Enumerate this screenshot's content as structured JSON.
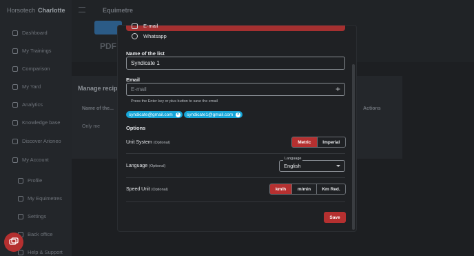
{
  "app": {
    "brand_prefix": "Horsotech",
    "user_name": "Charlotte",
    "page_title": "Equimetre",
    "background_heading": "PDF",
    "manage_heading": "Manage recip",
    "table": {
      "col_name": "Name of the...",
      "col_actions": "Actions",
      "row_1": "Only me"
    }
  },
  "sidebar": {
    "items": [
      {
        "label": "Dashboard",
        "icon": "grid-icon"
      },
      {
        "label": "My Trainings",
        "icon": "horse-icon"
      },
      {
        "label": "Comparison",
        "icon": "compare-icon"
      },
      {
        "label": "My Yard",
        "icon": "yard-icon"
      },
      {
        "label": "Analytics",
        "icon": "analytics-icon"
      },
      {
        "label": "Knowledge base",
        "icon": "bulb-icon"
      },
      {
        "label": "Discover Arioneo",
        "icon": "globe-icon"
      },
      {
        "label": "My Account",
        "icon": "users-icon"
      }
    ],
    "subitems": [
      {
        "label": "Profile",
        "icon": "user-icon"
      },
      {
        "label": "My Equimetres",
        "icon": "device-icon"
      },
      {
        "label": "Settings",
        "icon": "gear-icon"
      },
      {
        "label": "Back office",
        "icon": "office-icon"
      },
      {
        "label": "Help & Support",
        "icon": "help-icon"
      }
    ]
  },
  "modal": {
    "share_options": [
      {
        "label": "E-mail",
        "icon": "mail-icon"
      },
      {
        "label": "Whatsapp",
        "icon": "whatsapp-icon"
      }
    ],
    "name_label": "Name of the list",
    "name_value": "Syndicate 1",
    "email_label": "Email",
    "email_placeholder": "E-mail",
    "email_hint": "Press the Enter key or plus button to save the email",
    "emails": [
      "syndicate@gmail.com",
      "syndicate1@gmail.com"
    ],
    "options_label": "Options",
    "unit_system": {
      "label": "Unit System",
      "optional": "(Optional)",
      "choices": [
        "Metric",
        "Imperial"
      ],
      "selected": "Metric"
    },
    "language": {
      "label": "Language",
      "optional": "(Optional)",
      "legend": "Language",
      "value": "English"
    },
    "speed_unit": {
      "label": "Speed Unit",
      "optional": "(Optional)",
      "choices": [
        "km/h",
        "m/min",
        "Km Red."
      ],
      "selected": "km/h"
    },
    "save_label": "Save"
  },
  "colors": {
    "accent": "#b53030",
    "chip": "#16a6d8",
    "background": "#1d1f22"
  }
}
